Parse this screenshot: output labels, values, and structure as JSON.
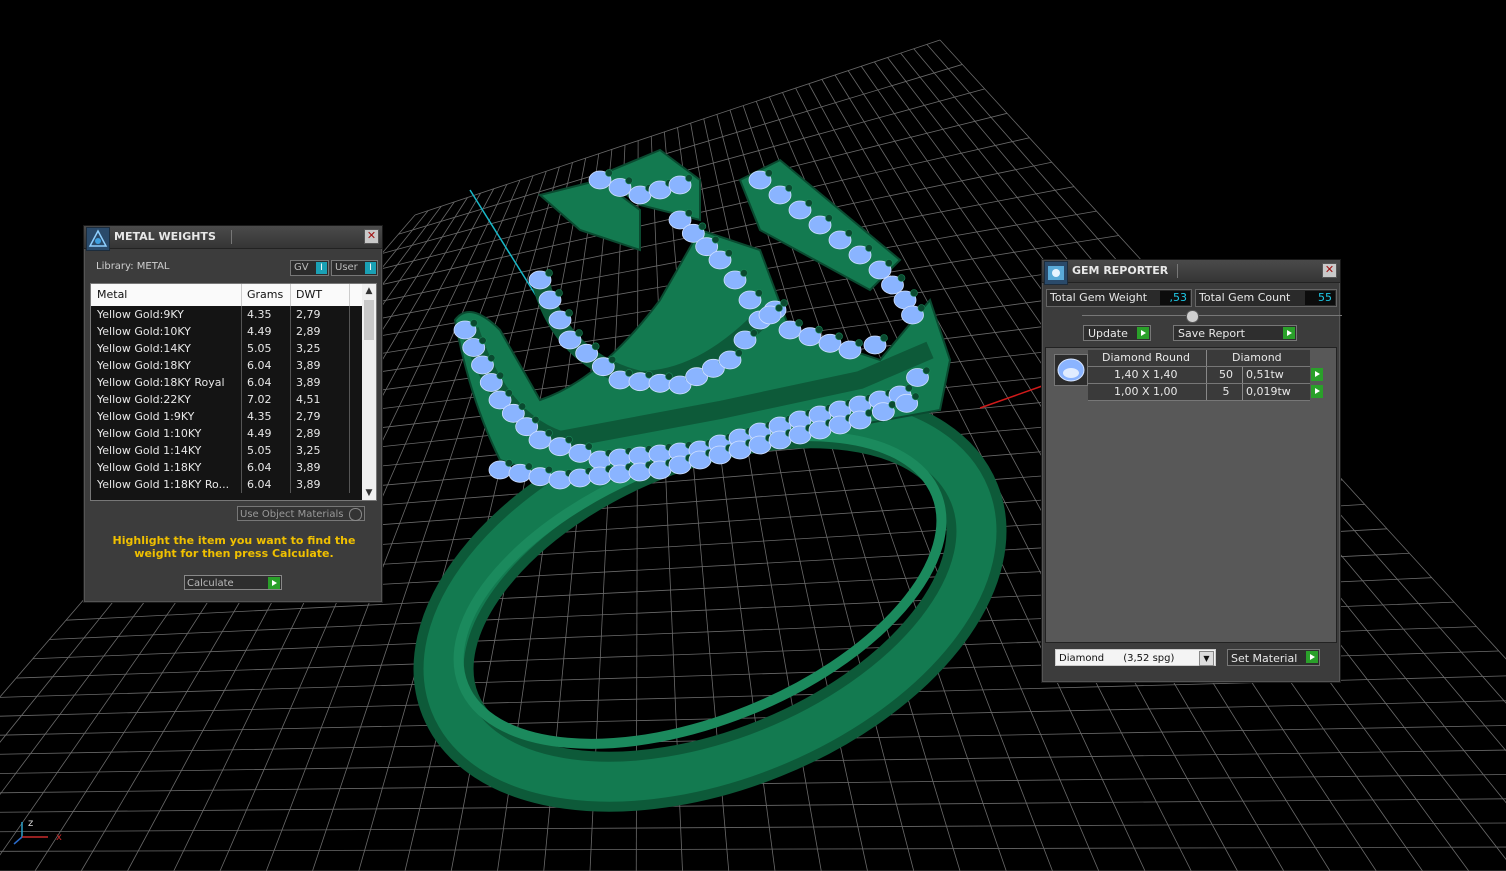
{
  "metal_weights": {
    "title": "METAL WEIGHTS",
    "library_label": "Library: METAL",
    "toggle_gv": "GV",
    "toggle_user": "User",
    "toggle_indicator": "I",
    "columns": [
      "Metal",
      "Grams",
      "DWT"
    ],
    "rows": [
      [
        "Yellow Gold:9KY",
        "4.35",
        "2,79"
      ],
      [
        "Yellow Gold:10KY",
        "4.49",
        "2,89"
      ],
      [
        "Yellow Gold:14KY",
        "5.05",
        "3,25"
      ],
      [
        "Yellow Gold:18KY",
        "6.04",
        "3,89"
      ],
      [
        "Yellow Gold:18KY Royal",
        "6.04",
        "3,89"
      ],
      [
        "Yellow Gold:22KY",
        "7.02",
        "4,51"
      ],
      [
        "Yellow Gold 1:9KY",
        "4.35",
        "2,79"
      ],
      [
        "Yellow Gold 1:10KY",
        "4.49",
        "2,89"
      ],
      [
        "Yellow Gold 1:14KY",
        "5.05",
        "3,25"
      ],
      [
        "Yellow Gold 1:18KY",
        "6.04",
        "3,89"
      ],
      [
        "Yellow Gold 1:18KY Ro...",
        "6.04",
        "3,89"
      ]
    ],
    "use_object_materials": "Use Object Materials",
    "hint": "Highlight the item you want to find the weight for then press Calculate.",
    "calculate": "Calculate",
    "close": "✕"
  },
  "gem_reporter": {
    "title": "GEM REPORTER",
    "total_weight_label": "Total Gem Weight",
    "total_weight_value": ",53",
    "total_count_label": "Total Gem Count",
    "total_count_value": "55",
    "update": "Update",
    "save_report": "Save Report",
    "gem_headers": [
      "Diamond Round",
      "Diamond"
    ],
    "gem_rows": [
      [
        "1,40 X 1,40",
        "50",
        "0,51tw"
      ],
      [
        "1,00 X 1,00",
        "5",
        "0,019tw"
      ]
    ],
    "material_selected": "Diamond      (3,52 spg)",
    "set_material": "Set Material",
    "close": "✕"
  },
  "axis": {
    "x": "x",
    "z": "z"
  },
  "colors": {
    "ring": "#0f6b44",
    "gem": "#8ab4ff",
    "prong": "#0a4a30",
    "grid": "#6a6a6a",
    "accent_go": "#2aa02a",
    "value_text": "#1ec8e6",
    "hint": "#f0c000"
  }
}
